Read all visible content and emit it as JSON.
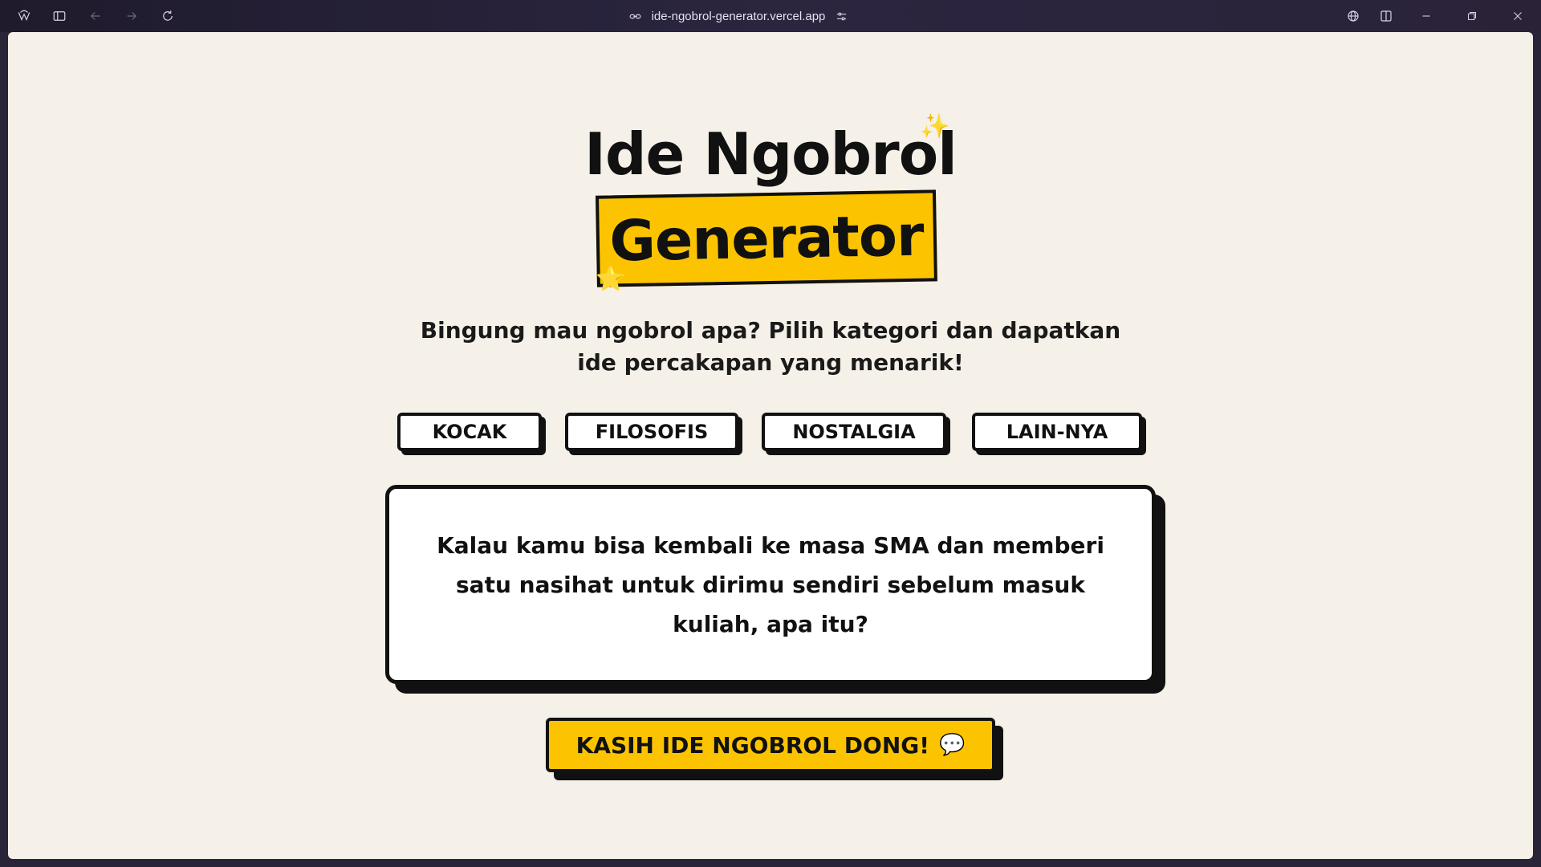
{
  "browser": {
    "url": "ide-ngobrol-generator.vercel.app"
  },
  "page": {
    "title_line1": "Ide Ngobrol",
    "title_line2": "Generator",
    "sparkle_emoji": "✨",
    "star_emoji": "⭐",
    "subtitle_line1": "Bingung mau ngobrol apa? Pilih kategori dan dapatkan",
    "subtitle_line2": "ide percakapan yang menarik!",
    "categories": [
      {
        "label": "KOCAK"
      },
      {
        "label": "FILOSOFIS"
      },
      {
        "label": "NOSTALGIA"
      },
      {
        "label": "LAIN-NYA"
      }
    ],
    "idea_text": "Kalau kamu bisa kembali ke masa SMA dan memberi satu nasihat untuk dirimu sendiri sebelum masuk kuliah, apa itu?",
    "cta_label": "KASIH IDE NGOBROL DONG!",
    "cta_emoji": "💬"
  },
  "colors": {
    "background": "#f5f0e8",
    "accent": "#fcc400",
    "ink": "#111111"
  }
}
